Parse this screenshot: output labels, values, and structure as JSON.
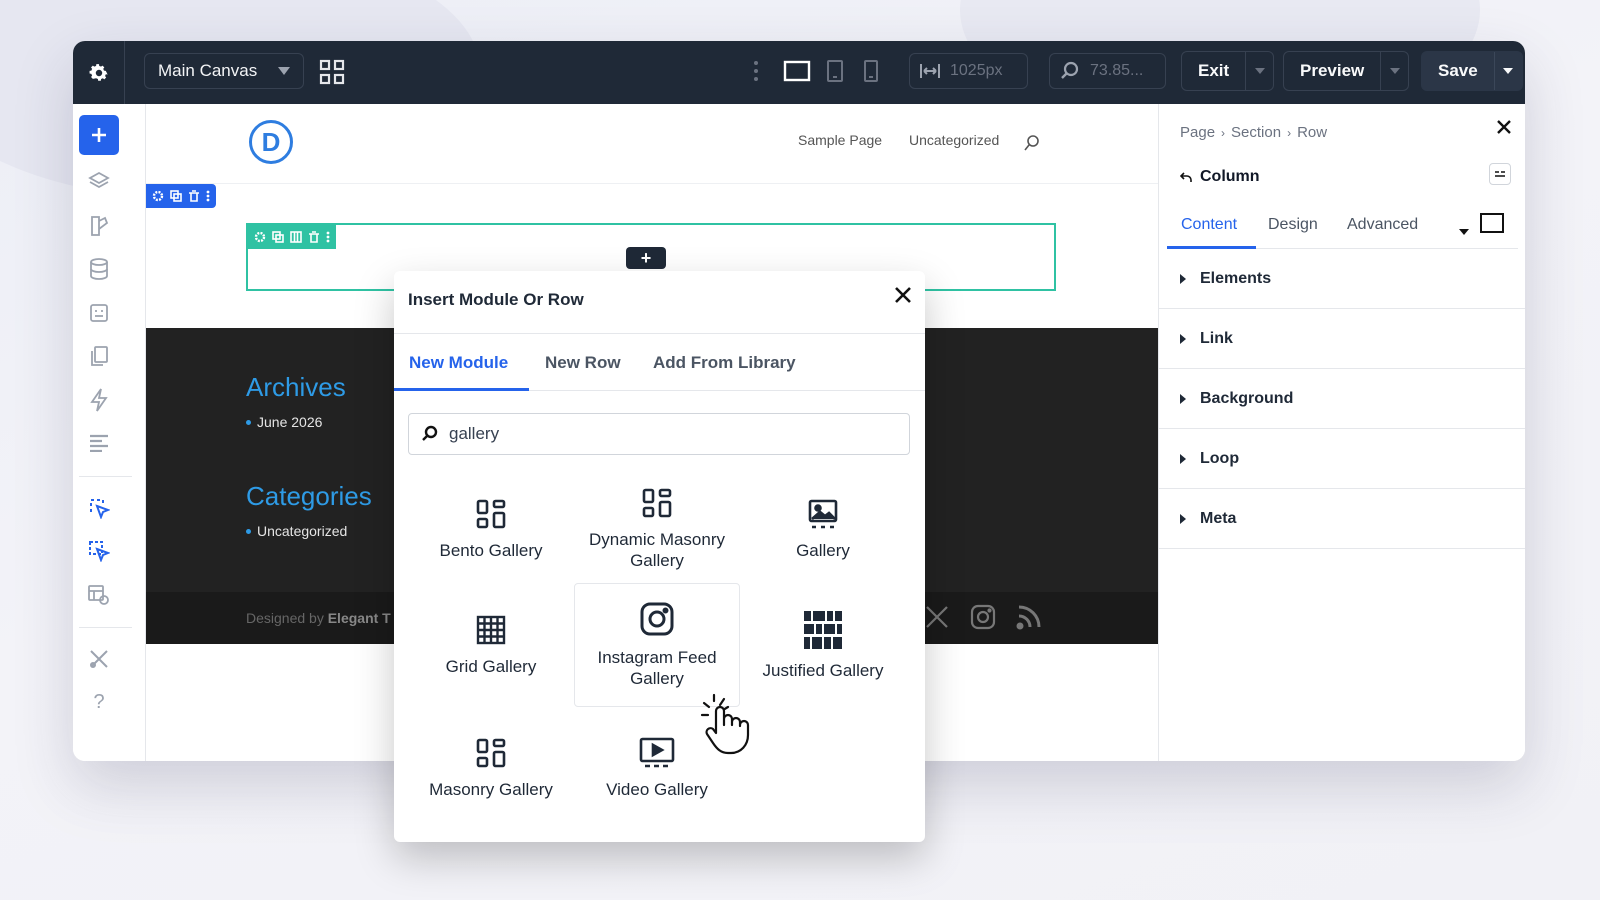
{
  "topbar": {
    "canvas_label": "Main Canvas",
    "width_value": "1025px",
    "zoom_value": "73.85...",
    "exit_label": "Exit",
    "preview_label": "Preview",
    "save_label": "Save"
  },
  "site": {
    "logo_letter": "D",
    "nav": [
      "Sample Page",
      "Uncategorized"
    ],
    "archives_title": "Archives",
    "archives_items": [
      "June 2026"
    ],
    "categories_title": "Categories",
    "categories_items": [
      "Uncategorized"
    ],
    "credit_prefix": "Designed by",
    "credit_brand": "Elegant T"
  },
  "panel": {
    "breadcrumb": [
      "Page",
      "Section",
      "Row"
    ],
    "element_title": "Column",
    "tabs": [
      "Content",
      "Design",
      "Advanced"
    ],
    "active_tab": "Content",
    "sections": [
      "Elements",
      "Link",
      "Background",
      "Loop",
      "Meta"
    ]
  },
  "modal": {
    "title": "Insert Module Or Row",
    "tabs": [
      "New Module",
      "New Row",
      "Add From Library"
    ],
    "active_tab": "New Module",
    "search_value": "gallery",
    "modules": [
      {
        "label": "Bento Gallery",
        "icon": "bento-gallery-icon"
      },
      {
        "label": "Dynamic Masonry Gallery",
        "icon": "dynamic-masonry-gallery-icon"
      },
      {
        "label": "Gallery",
        "icon": "gallery-icon"
      },
      {
        "label": "Grid Gallery",
        "icon": "grid-gallery-icon"
      },
      {
        "label": "Instagram Feed Gallery",
        "icon": "instagram-icon",
        "hovered": true
      },
      {
        "label": "Justified Gallery",
        "icon": "justified-gallery-icon"
      },
      {
        "label": "Masonry Gallery",
        "icon": "masonry-gallery-icon"
      },
      {
        "label": "Video Gallery",
        "icon": "video-gallery-icon"
      }
    ]
  },
  "colors": {
    "accent": "#2563eb",
    "row_outline": "#2fc2a3",
    "topbar_bg": "#1f2937",
    "footer_link": "#2e9be6"
  }
}
